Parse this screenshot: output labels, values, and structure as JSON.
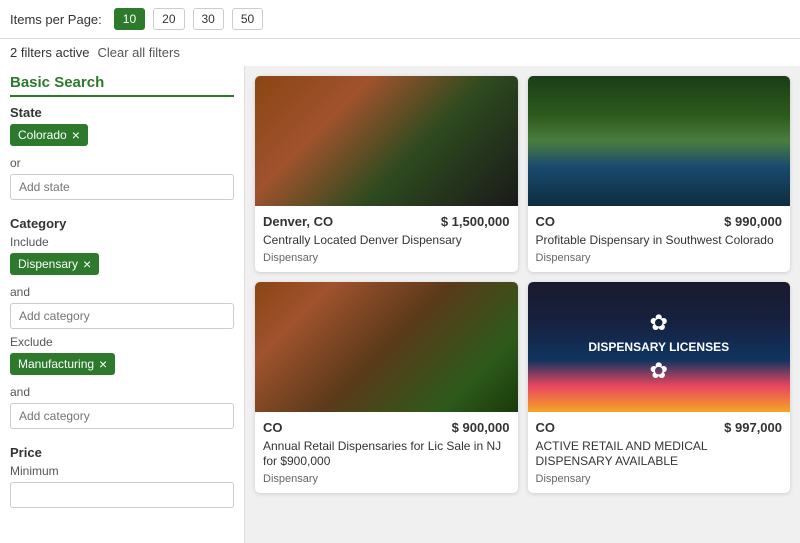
{
  "topbar": {
    "items_per_page_label": "Items per Page:",
    "per_page_options": [
      "10",
      "20",
      "30",
      "50"
    ],
    "active_per_page": "10"
  },
  "filters_bar": {
    "active_count": "2 filters active",
    "clear_label": "Clear all filters"
  },
  "sidebar": {
    "section_title": "Basic Search",
    "state": {
      "label": "State",
      "include_tag": "Colorado",
      "or_label": "or",
      "add_placeholder": "Add state"
    },
    "category": {
      "label": "Category",
      "include_label": "Include",
      "include_tag": "Dispensary",
      "and_label": "and",
      "add_include_placeholder": "Add category",
      "exclude_label": "Exclude",
      "exclude_tag": "Manufacturing",
      "and_label2": "and",
      "add_exclude_placeholder": "Add category"
    },
    "price": {
      "label": "Price",
      "min_label": "Minimum"
    }
  },
  "listings": [
    {
      "id": "1",
      "location": "Denver, CO",
      "price": "$ 1,500,000",
      "title": "Centrally Located Denver Dispensary",
      "category": "Dispensary",
      "image_type": "dispensary-shop"
    },
    {
      "id": "2",
      "location": "CO",
      "price": "$ 990,000",
      "title": "Profitable Dispensary in Southwest Colorado",
      "category": "Dispensary",
      "image_type": "river"
    },
    {
      "id": "3",
      "location": "CO",
      "price": "$ 900,000",
      "title": "Annual Retail Dispensaries for Lic Sale in NJ for $900,000",
      "category": "Dispensary",
      "image_type": "store-shelf"
    },
    {
      "id": "4",
      "location": "CO",
      "price": "$ 997,000",
      "title": "ACTIVE RETAIL AND MEDICAL DISPENSARY AVAILABLE",
      "category": "Dispensary",
      "image_type": "dispensary-licenses"
    }
  ]
}
